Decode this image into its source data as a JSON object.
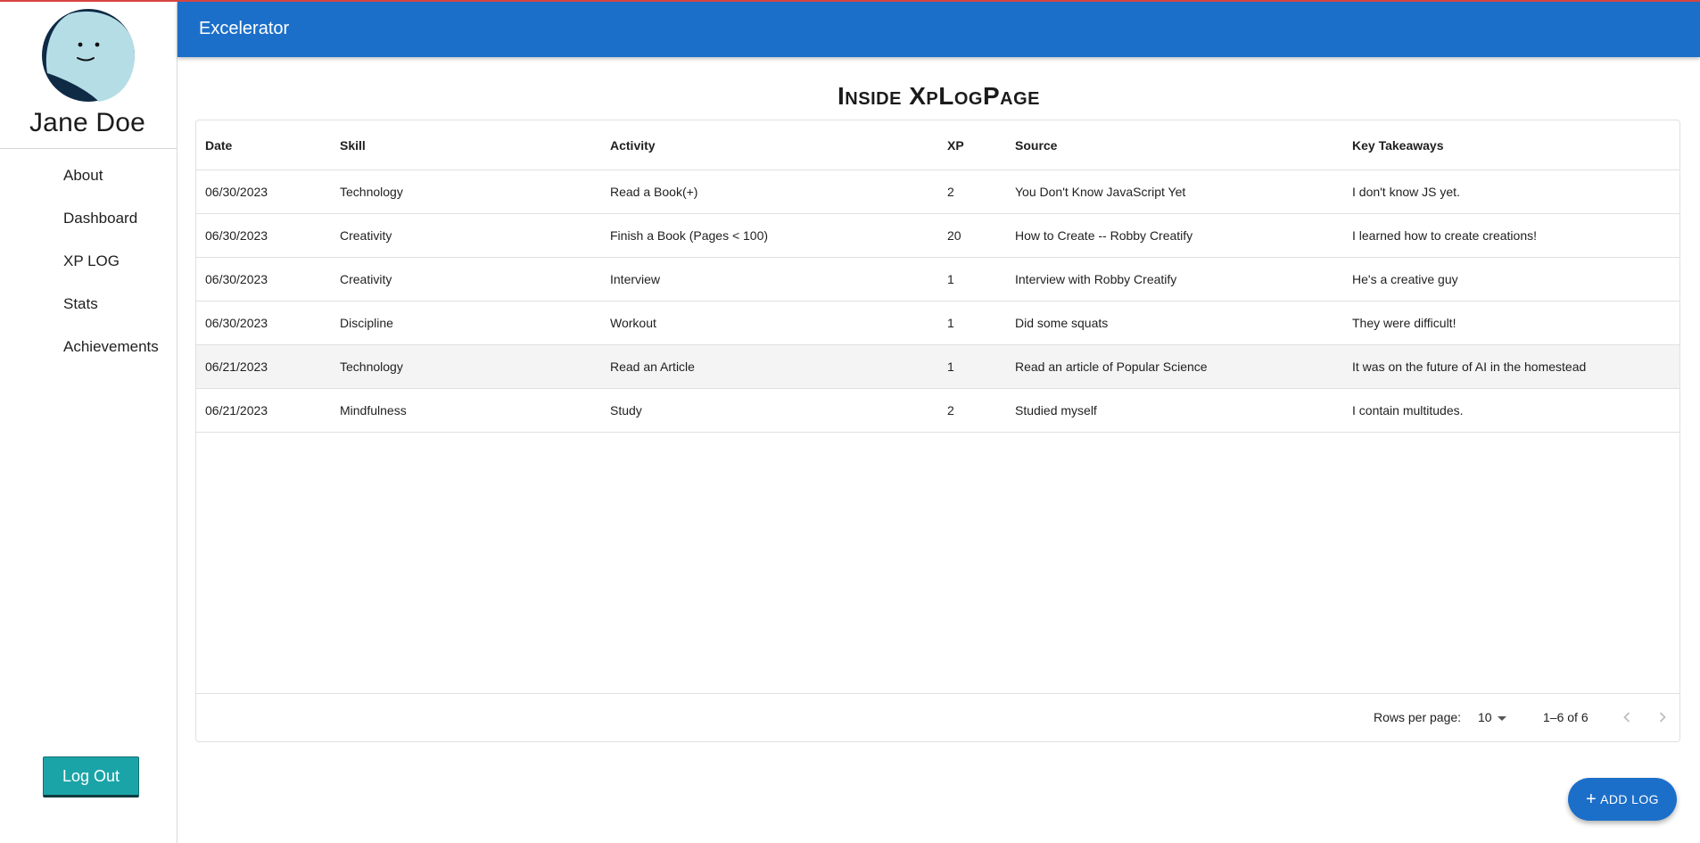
{
  "app": {
    "title": "Excelerator"
  },
  "user": {
    "name": "Jane Doe",
    "avatar_icon": "smiley-avatar-icon"
  },
  "sidebar": {
    "items": [
      {
        "label": "About"
      },
      {
        "label": "Dashboard"
      },
      {
        "label": "XP LOG"
      },
      {
        "label": "Stats"
      },
      {
        "label": "Achievements"
      }
    ],
    "logout_label": "Log Out"
  },
  "page": {
    "title": "Inside XpLogPage"
  },
  "table": {
    "columns": [
      "Date",
      "Skill",
      "Activity",
      "XP",
      "Source",
      "Key Takeaways"
    ],
    "rows": [
      {
        "date": "06/30/2023",
        "skill": "Technology",
        "activity": "Read a Book(+)",
        "xp": "2",
        "source": "You Don't Know JavaScript Yet",
        "takeaways": "I don't know JS yet."
      },
      {
        "date": "06/30/2023",
        "skill": "Creativity",
        "activity": "Finish a Book (Pages < 100)",
        "xp": "20",
        "source": "How to Create -- Robby Creatify",
        "takeaways": "I learned how to create creations!"
      },
      {
        "date": "06/30/2023",
        "skill": "Creativity",
        "activity": "Interview",
        "xp": "1",
        "source": "Interview with Robby Creatify",
        "takeaways": "He's a creative guy"
      },
      {
        "date": "06/30/2023",
        "skill": "Discipline",
        "activity": "Workout",
        "xp": "1",
        "source": "Did some squats",
        "takeaways": "They were difficult!"
      },
      {
        "date": "06/21/2023",
        "skill": "Technology",
        "activity": "Read an Article",
        "xp": "1",
        "source": "Read an article of Popular Science",
        "takeaways": "It was on the future of AI in the homestead"
      },
      {
        "date": "06/21/2023",
        "skill": "Mindfulness",
        "activity": "Study",
        "xp": "2",
        "source": "Studied myself",
        "takeaways": "I contain multitudes."
      }
    ],
    "footer": {
      "rows_per_page_label": "Rows per page:",
      "rows_per_page_value": "10",
      "range": "1–6 of 6"
    }
  },
  "fab": {
    "label": "ADD LOG",
    "icon": "plus-icon"
  },
  "colors": {
    "appbar": "#1b6fc9",
    "logout": "#1ba4a8",
    "avatar_bg": "#b5dde6",
    "avatar_dark": "#0f2a45"
  }
}
